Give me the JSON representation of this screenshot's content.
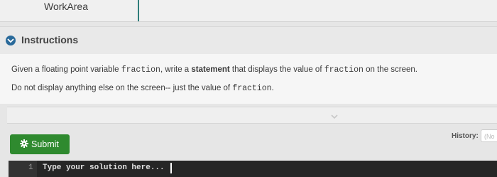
{
  "workarea": {
    "tab_label": "WorkArea"
  },
  "instructions": {
    "title": "Instructions",
    "line1": {
      "t1": "Given a floating point variable ",
      "code1": "fraction",
      "t2": ", write a ",
      "bold": "statement",
      "t3": " that displays the value of ",
      "code2": "fraction",
      "t4": " on the screen."
    },
    "line2": {
      "t1": "Do not display anything else on the screen-- just the value of ",
      "code1": "fraction",
      "t2": "."
    }
  },
  "submit": {
    "label": "Submit",
    "icon": "gear-icon"
  },
  "history": {
    "label": "History:",
    "selected": "(No"
  },
  "editor": {
    "line_number": "1",
    "placeholder": "Type your solution here..."
  },
  "colors": {
    "submit_bg": "#2f8a2f",
    "instructions_icon": "#2a6a9a",
    "editor_bg": "#262626",
    "tab_accent": "#2f7d7a"
  }
}
